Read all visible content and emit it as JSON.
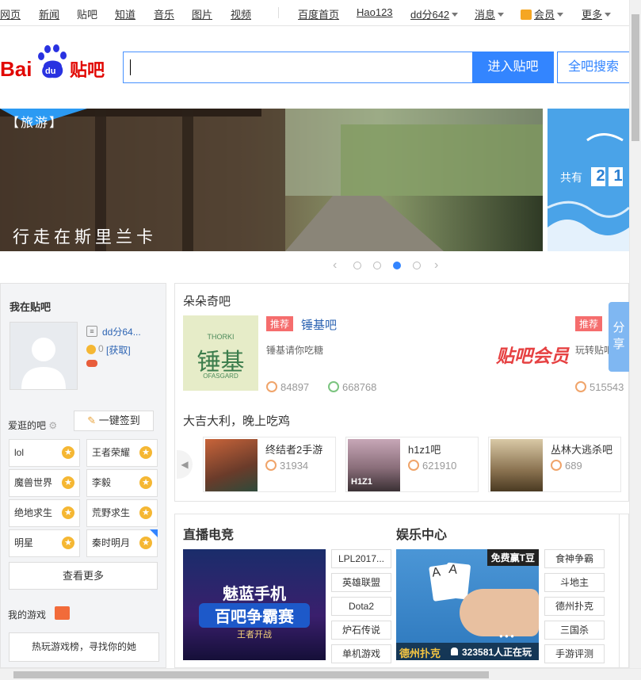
{
  "topnav": {
    "left": [
      "网页",
      "新闻",
      "贴吧",
      "知道",
      "音乐",
      "图片",
      "视频"
    ],
    "right": {
      "home": "百度首页",
      "hao123": "Hao123",
      "user": "dd分642",
      "msg": "消息",
      "vip": "会员",
      "more": "更多"
    }
  },
  "header": {
    "logo_text": "Baidu贴吧",
    "search_value": "",
    "enter_button": "进入贴吧",
    "all_search_button": "全吧搜索"
  },
  "banner": {
    "tag": "【旅游】",
    "caption": "行走在斯里兰卡",
    "side_text": "共有",
    "side_digits": [
      "2",
      "1"
    ],
    "dots": 4,
    "active_dot": 3
  },
  "left": {
    "title": "我在贴吧",
    "username": "dd分64...",
    "tbean": "0",
    "get_link": "[获取]",
    "fav_title": "爱逛的吧",
    "signin_button": "一键签到",
    "tiebas": [
      "lol",
      "王者荣耀",
      "魔兽世界",
      "李毅",
      "绝地求生",
      "荒野求生",
      "明星",
      "秦时明月"
    ],
    "more_button": "查看更多",
    "games_title": "我的游戏",
    "games_button": "热玩游戏榜，寻找你的她"
  },
  "mid": {
    "section_title": "朵朵奇吧",
    "rec_tag": "推荐",
    "rec_name": "锤基吧",
    "rec_desc": "锤基请你吃糖",
    "rec_members": "84897",
    "rec_posts": "668768",
    "rec_thumb_text": "锤基",
    "rec_thumb_top": "THORKI",
    "rec_thumb_bottom": "OFASGARD",
    "vip_logo": "贴吧会员",
    "rec2_tag": "推荐",
    "rec2_desc": "玩转贴吧",
    "rec2_members": "515543",
    "share": "分享",
    "games_title": "大吉大利，晚上吃鸡",
    "games": [
      {
        "name": "终结者2手游",
        "count": "31934"
      },
      {
        "name": "h1z1吧",
        "count": "621910"
      },
      {
        "name": "丛林大逃杀吧",
        "count": "689"
      }
    ]
  },
  "bottom": {
    "live_title": "直播电竞",
    "live_banner_line1": "魅蓝手机",
    "live_banner_line2": "百吧争霸赛",
    "live_banner_line3": "王者开战",
    "live_buttons": [
      "LPL2017...",
      "英雄联盟",
      "Dota2",
      "炉石传说",
      "单机游戏"
    ],
    "ent_title": "娱乐中心",
    "ent_badge": "免费赢T豆",
    "ent_caption": "德州扑克",
    "ent_online": "323581人正在玩",
    "ent_buttons": [
      "食神争霸",
      "斗地主",
      "德州扑克",
      "三国杀",
      "手游评测"
    ]
  }
}
